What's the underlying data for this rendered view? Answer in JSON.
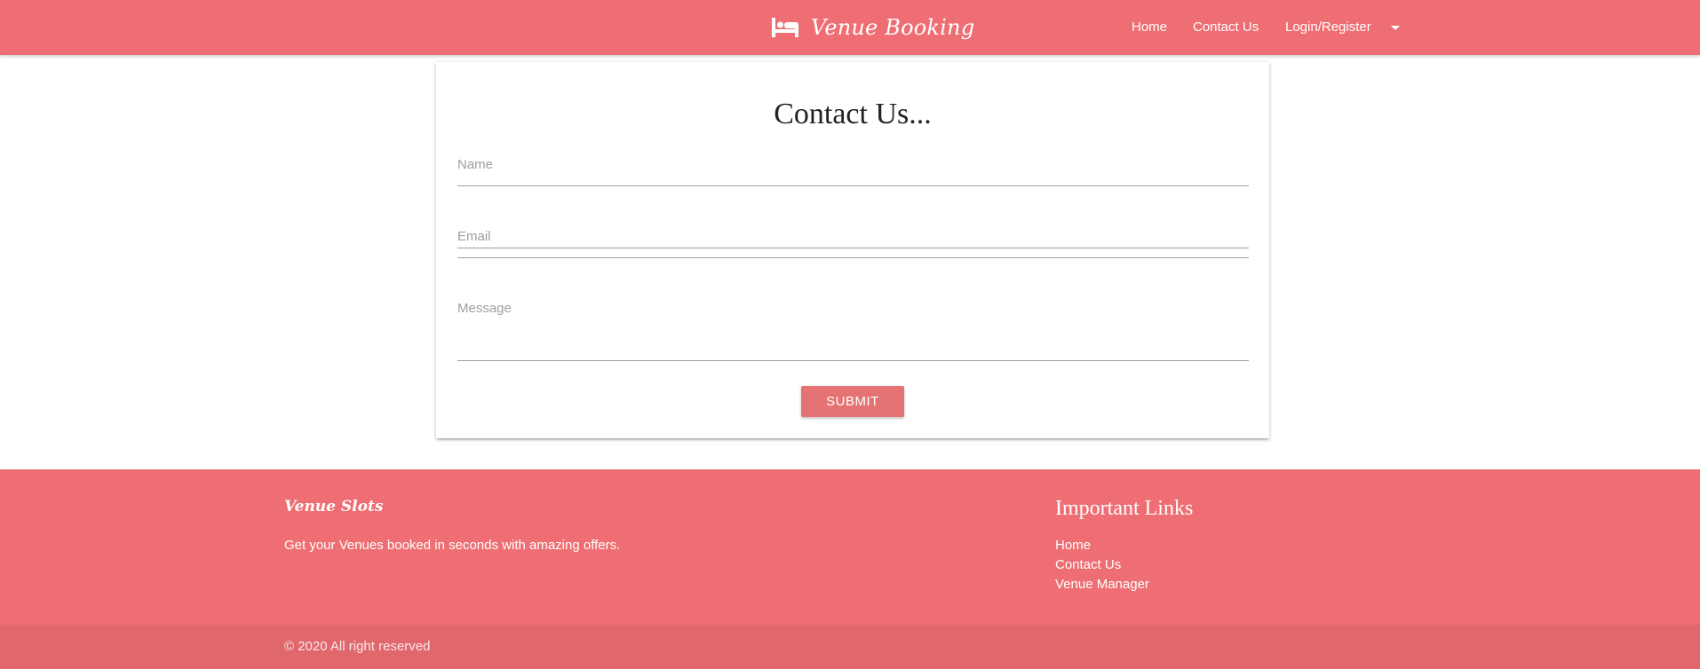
{
  "navbar": {
    "brand": "Venue Booking",
    "brand_icon": "bed-icon",
    "links": [
      {
        "label": "Home"
      },
      {
        "label": "Contact Us"
      },
      {
        "label": "Login/Register"
      }
    ],
    "dropdown_icon": "caret-down-icon"
  },
  "contact": {
    "title": "Contact Us...",
    "fields": {
      "name": {
        "label": "Name",
        "value": ""
      },
      "email": {
        "label": "Email",
        "value": ""
      },
      "message": {
        "label": "Message",
        "value": ""
      }
    },
    "submit_label": "SUBMIT"
  },
  "footer": {
    "brand": "Venue Slots",
    "tagline": "Get your Venues booked in seconds with amazing offers.",
    "links_title": "Important Links",
    "links": [
      {
        "label": "Home"
      },
      {
        "label": "Contact Us"
      },
      {
        "label": "Venue Manager"
      }
    ],
    "copyright": "© 2020 All right reserved"
  },
  "colors": {
    "primary": "#ee6e73",
    "button": "#e57373",
    "footer_bottom": "#e0676c"
  }
}
